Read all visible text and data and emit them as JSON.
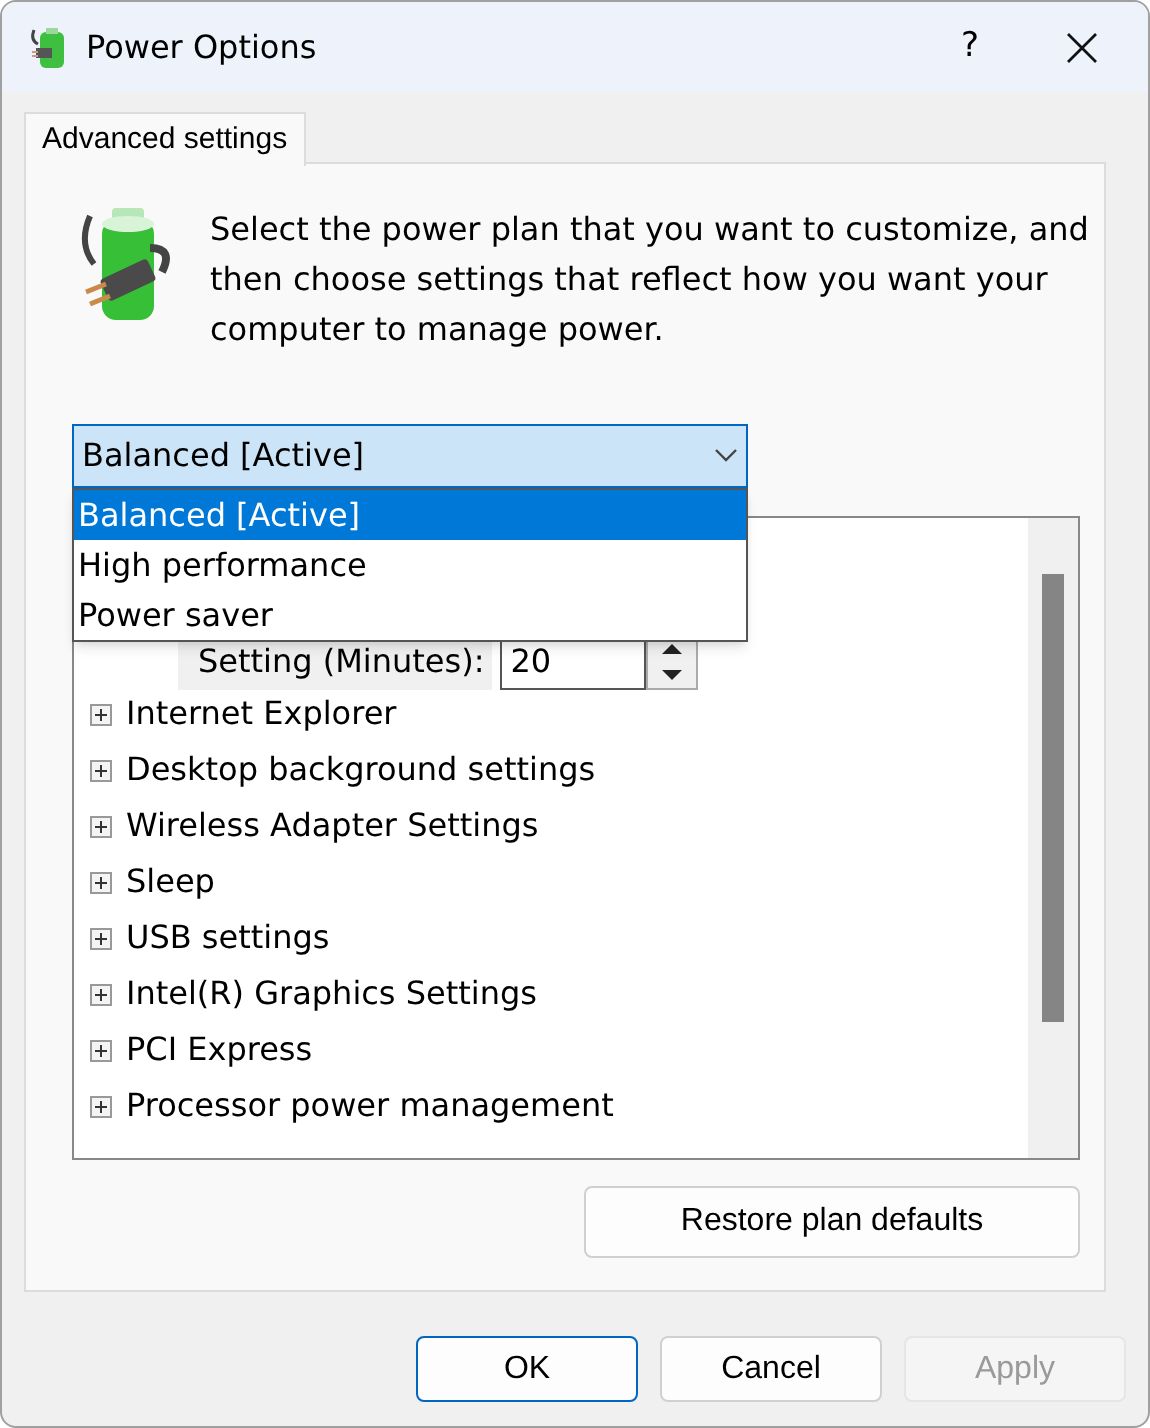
{
  "window": {
    "title": "Power Options",
    "help": "?"
  },
  "tabs": [
    {
      "label": "Advanced settings",
      "selected": true
    }
  ],
  "description": "Select the power plan that you want to customize, and then choose settings that reflect how you want your computer to manage power.",
  "plan_dropdown": {
    "value": "Balanced [Active]",
    "expanded": true,
    "options": [
      {
        "label": "Balanced [Active]",
        "selected": true
      },
      {
        "label": "High performance",
        "selected": false
      },
      {
        "label": "Power saver",
        "selected": false
      }
    ]
  },
  "setting": {
    "label": "Setting (Minutes):",
    "value": "20"
  },
  "tree": [
    {
      "label": "Internet Explorer",
      "expanded": false
    },
    {
      "label": "Desktop background settings",
      "expanded": false
    },
    {
      "label": "Wireless Adapter Settings",
      "expanded": false
    },
    {
      "label": "Sleep",
      "expanded": false
    },
    {
      "label": "USB settings",
      "expanded": false
    },
    {
      "label": "Intel(R) Graphics Settings",
      "expanded": false
    },
    {
      "label": "PCI Express",
      "expanded": false
    },
    {
      "label": "Processor power management",
      "expanded": false
    }
  ],
  "restore_button": "Restore plan defaults",
  "buttons": [
    {
      "label": "OK",
      "kind": "default"
    },
    {
      "label": "Cancel",
      "kind": "normal"
    },
    {
      "label": "Apply",
      "kind": "disabled"
    }
  ]
}
